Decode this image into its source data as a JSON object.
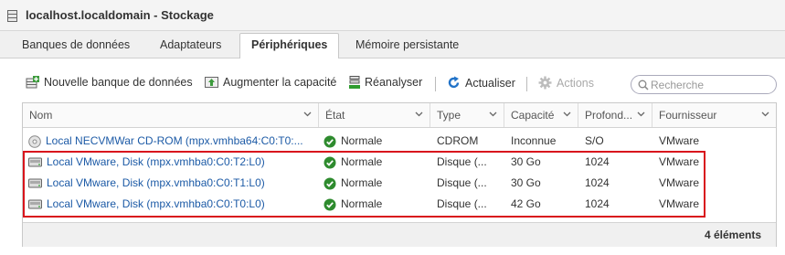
{
  "window": {
    "title": "localhost.localdomain - Stockage"
  },
  "tabs": [
    {
      "label": "Banques de données",
      "active": false
    },
    {
      "label": "Adaptateurs",
      "active": false
    },
    {
      "label": "Périphériques",
      "active": true
    },
    {
      "label": "Mémoire persistante",
      "active": false
    }
  ],
  "toolbar": {
    "new_datastore": "Nouvelle banque de données",
    "increase_capacity": "Augmenter la capacité",
    "rescan": "Réanalyser",
    "refresh": "Actualiser",
    "actions": "Actions"
  },
  "search": {
    "placeholder": "Recherche",
    "value": ""
  },
  "table": {
    "columns": [
      "Nom",
      "État",
      "Type",
      "Capacité",
      "Profond...",
      "Fournisseur"
    ],
    "rows": [
      {
        "icon": "cdrom-icon",
        "name": "Local NECVMWar CD-ROM (mpx.vmhba64:C0:T0:...",
        "status": "Normale",
        "type": "CDROM",
        "capacity": "Inconnue",
        "depth": "S/O",
        "vendor": "VMware",
        "selected": false
      },
      {
        "icon": "disk-icon",
        "name": "Local VMware, Disk (mpx.vmhba0:C0:T2:L0)",
        "status": "Normale",
        "type": "Disque (...",
        "capacity": "30 Go",
        "depth": "1024",
        "vendor": "VMware",
        "selected": false
      },
      {
        "icon": "disk-icon",
        "name": "Local VMware, Disk (mpx.vmhba0:C0:T1:L0)",
        "status": "Normale",
        "type": "Disque (...",
        "capacity": "30 Go",
        "depth": "1024",
        "vendor": "VMware",
        "selected": false
      },
      {
        "icon": "disk-icon",
        "name": "Local VMware, Disk (mpx.vmhba0:C0:T0:L0)",
        "status": "Normale",
        "type": "Disque (...",
        "capacity": "42 Go",
        "depth": "1024",
        "vendor": "VMware",
        "selected": false
      }
    ],
    "footer": "4 éléments"
  },
  "colors": {
    "link": "#1c5aa6",
    "status_ok": "#2e8b2e",
    "highlight": "#d9141c",
    "refresh_icon": "#2273c8"
  }
}
